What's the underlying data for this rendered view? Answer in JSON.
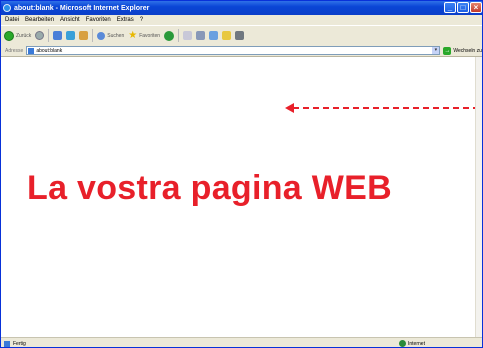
{
  "window": {
    "title": "about:blank - Microsoft Internet Explorer"
  },
  "menu": [
    "Datei",
    "Bearbeiten",
    "Ansicht",
    "Favoriten",
    "Extras",
    "?"
  ],
  "toolbar": {
    "back_label": "Zurück",
    "search_label": "Suchen",
    "favorites_label": "Favoriten"
  },
  "address": {
    "label": "Adresse",
    "value": "about:blank",
    "go_label": "Wechseln zu"
  },
  "content": {
    "headline": "La vostra pagina WEB"
  },
  "status": {
    "text": "Fertig",
    "zone": "Internet"
  },
  "colors": {
    "accent_red": "#e8202a",
    "titlebar_blue": "#0b3fc9"
  }
}
